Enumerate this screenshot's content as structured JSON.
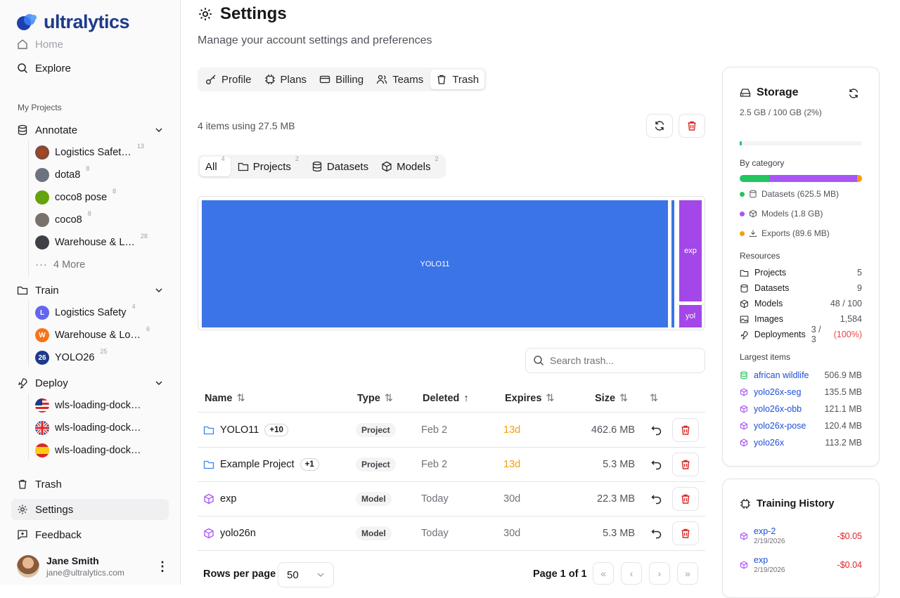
{
  "brand": {
    "name": "ultralytics"
  },
  "sidebar": {
    "home": "Home",
    "explore": "Explore",
    "section_label": "My Projects",
    "annotate": {
      "label": "Annotate",
      "items": [
        {
          "label": "Logistics Safet…",
          "count": "13"
        },
        {
          "label": "dota8",
          "count": "8"
        },
        {
          "label": "coco8 pose",
          "count": "8"
        },
        {
          "label": "coco8",
          "count": "8"
        },
        {
          "label": "Warehouse & L…",
          "count": "28"
        }
      ],
      "more": "4 More"
    },
    "train": {
      "label": "Train",
      "items": [
        {
          "label": "Logistics Safety",
          "count": "4",
          "letter": "L"
        },
        {
          "label": "Warehouse & Lo…",
          "count": "6",
          "letter": "W"
        },
        {
          "label": "YOLO26",
          "count": "25",
          "letter": "26"
        }
      ]
    },
    "deploy": {
      "label": "Deploy",
      "items": [
        {
          "label": "wls-loading-dock…"
        },
        {
          "label": "wls-loading-dock…"
        },
        {
          "label": "wls-loading-dock…"
        }
      ]
    },
    "trash": "Trash",
    "settings": "Settings",
    "feedback": "Feedback",
    "user": {
      "name": "Jane Smith",
      "email": "jane@ultralytics.com"
    }
  },
  "header": {
    "title": "Settings",
    "subtitle": "Manage your account settings and preferences"
  },
  "tabs": [
    "Profile",
    "Plans",
    "Billing",
    "Teams",
    "Trash"
  ],
  "trash": {
    "summary": "4 items using 27.5 MB",
    "filters": [
      {
        "label": "All",
        "count": "4"
      },
      {
        "label": "Projects",
        "count": "2"
      },
      {
        "label": "Datasets",
        "count": ""
      },
      {
        "label": "Models",
        "count": "2"
      }
    ],
    "treemap": {
      "big": "YOLO11",
      "small1": "exp",
      "small2": "yol"
    },
    "search_placeholder": "Search trash...",
    "columns": [
      "Name",
      "Type",
      "Deleted",
      "Expires",
      "Size"
    ],
    "rows": [
      {
        "name": "YOLO11",
        "extra": "+10",
        "type": "Project",
        "deleted": "Feb 2",
        "expires": "13d",
        "size": "462.6 MB"
      },
      {
        "name": "Example Project",
        "extra": "+1",
        "type": "Project",
        "deleted": "Feb 2",
        "expires": "13d",
        "size": "5.3 MB"
      },
      {
        "name": "exp",
        "extra": "",
        "type": "Model",
        "deleted": "Today",
        "expires": "30d",
        "size": "22.3 MB"
      },
      {
        "name": "yolo26n",
        "extra": "",
        "type": "Model",
        "deleted": "Today",
        "expires": "30d",
        "size": "5.3 MB"
      }
    ],
    "rows_per_page_label": "Rows per page",
    "rows_per_page": "50",
    "page_info": "Page 1 of 1"
  },
  "storage": {
    "title": "Storage",
    "usage": "2.5 GB / 100 GB (2%)",
    "usage_fraction": 0.02,
    "by_category_label": "By category",
    "categories": [
      {
        "label": "Datasets (625.5 MB)",
        "color": "#22c55e"
      },
      {
        "label": "Models (1.8 GB)",
        "color": "#a855f7"
      },
      {
        "label": "Exports (89.6 MB)",
        "color": "#f59e0b"
      }
    ],
    "resources_label": "Resources",
    "resources": [
      {
        "label": "Projects",
        "value": "5"
      },
      {
        "label": "Datasets",
        "value": "9"
      },
      {
        "label": "Models",
        "value": "48 / 100"
      },
      {
        "label": "Images",
        "value": "1,584"
      },
      {
        "label": "Deployments",
        "value": "3 / 3",
        "extra": "(100%)"
      }
    ],
    "largest_label": "Largest items",
    "largest": [
      {
        "name": "african wildlife",
        "size": "506.9 MB"
      },
      {
        "name": "yolo26x-seg",
        "size": "135.5 MB"
      },
      {
        "name": "yolo26x-obb",
        "size": "121.1 MB"
      },
      {
        "name": "yolo26x-pose",
        "size": "120.4 MB"
      },
      {
        "name": "yolo26x",
        "size": "113.2 MB"
      }
    ]
  },
  "training_history": {
    "title": "Training History",
    "items": [
      {
        "name": "exp-2",
        "date": "2/19/2026",
        "cost": "-$0.05"
      },
      {
        "name": "exp",
        "date": "2/19/2026",
        "cost": "-$0.04"
      }
    ]
  }
}
